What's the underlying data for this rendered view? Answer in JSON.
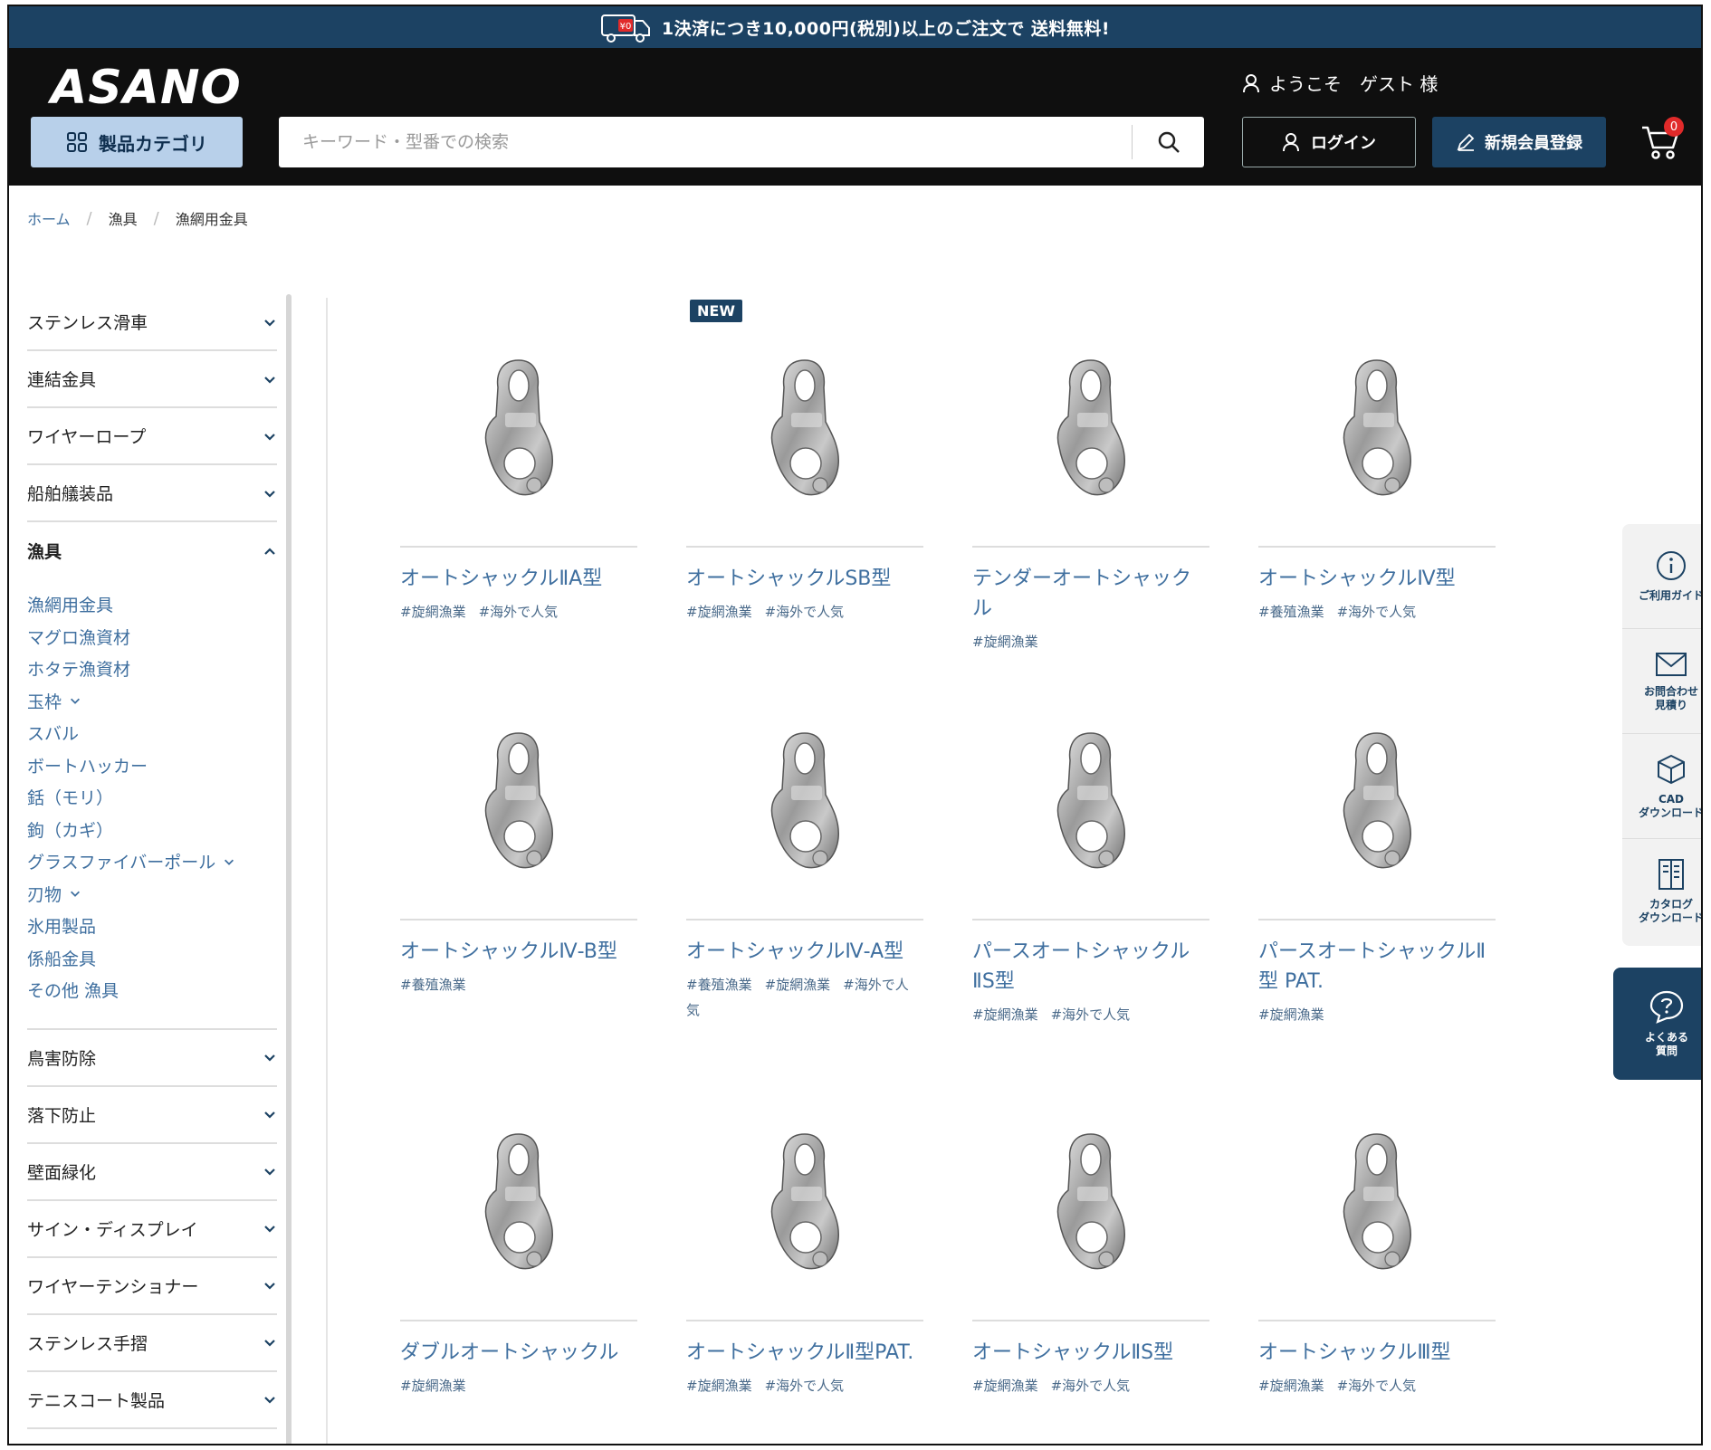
{
  "banner": {
    "text": "1決済につき10,000円(税別)以上のご注文で 送料無料!",
    "truck_label": "¥0"
  },
  "header": {
    "logo": "ASANO",
    "welcome": "ようこそ　ゲスト 様",
    "category_button": "製品カテゴリ",
    "search_placeholder": "キーワード・型番での検索",
    "login": "ログイン",
    "register": "新規会員登録",
    "cart_count": "0"
  },
  "breadcrumb": {
    "home": "ホーム",
    "level1": "漁具",
    "level2": "漁網用金具"
  },
  "sidebar": {
    "categories_top": [
      "ステンレス滑車",
      "連結金具",
      "ワイヤーロープ",
      "船舶艤装品"
    ],
    "open_category": "漁具",
    "subitems": [
      {
        "label": "漁網用金具",
        "expandable": false
      },
      {
        "label": "マグロ漁資材",
        "expandable": false
      },
      {
        "label": "ホタテ漁資材",
        "expandable": false
      },
      {
        "label": "玉枠",
        "expandable": true
      },
      {
        "label": "スバル",
        "expandable": false
      },
      {
        "label": "ボートハッカー",
        "expandable": false
      },
      {
        "label": "銛（モリ）",
        "expandable": false
      },
      {
        "label": "鉤（カギ）",
        "expandable": false
      },
      {
        "label": "グラスファイバーポール",
        "expandable": true
      },
      {
        "label": "刃物",
        "expandable": true
      },
      {
        "label": "氷用製品",
        "expandable": false
      },
      {
        "label": "係船金具",
        "expandable": false
      },
      {
        "label": "その他 漁具",
        "expandable": false
      }
    ],
    "categories_bottom": [
      "鳥害防除",
      "落下防止",
      "壁面緑化",
      "サイン・ディスプレイ",
      "ワイヤーテンショナー",
      "ステンレス手摺",
      "テニスコート製品"
    ]
  },
  "new_badge": "NEW",
  "products": [
    {
      "name": "オートシャックルⅡA型",
      "tags": [
        "#旋網漁業",
        "#海外で人気"
      ]
    },
    {
      "name": "オートシャックルSB型",
      "tags": [
        "#旋網漁業",
        "#海外で人気"
      ]
    },
    {
      "name": "テンダーオートシャックル",
      "tags": [
        "#旋網漁業"
      ]
    },
    {
      "name": "オートシャックルⅣ型",
      "tags": [
        "#養殖漁業",
        "#海外で人気"
      ]
    },
    {
      "name": "オートシャックルⅣ-B型",
      "tags": [
        "#養殖漁業"
      ]
    },
    {
      "name": "オートシャックルⅣ-A型",
      "tags": [
        "#養殖漁業",
        "#旋網漁業",
        "#海外で人気"
      ]
    },
    {
      "name": "パースオートシャックルⅡS型",
      "tags": [
        "#旋網漁業",
        "#海外で人気"
      ]
    },
    {
      "name": "パースオートシャックルⅡ型 PAT.",
      "tags": [
        "#旋網漁業"
      ]
    },
    {
      "name": "ダブルオートシャックル",
      "tags": [
        "#旋網漁業"
      ]
    },
    {
      "name": "オートシャックルⅡ型PAT.",
      "tags": [
        "#旋網漁業",
        "#海外で人気"
      ]
    },
    {
      "name": "オートシャックルⅡS型",
      "tags": [
        "#旋網漁業",
        "#海外で人気"
      ]
    },
    {
      "name": "オートシャックルⅢ型",
      "tags": [
        "#旋網漁業",
        "#海外で人気"
      ]
    }
  ],
  "float_panel": {
    "guide": "ご利用ガイド",
    "contact": "お問合わせ\n見積り",
    "cad": "CAD\nダウンロード",
    "catalog": "カタログ\nダウンロード",
    "faq": "よくある\n質問"
  },
  "colors": {
    "navy": "#1c4263",
    "link_blue": "#3f6f9f",
    "light_blue_button": "#b8d0ea",
    "header_black": "#0f0f0f",
    "badge_red": "#e12a2a"
  }
}
